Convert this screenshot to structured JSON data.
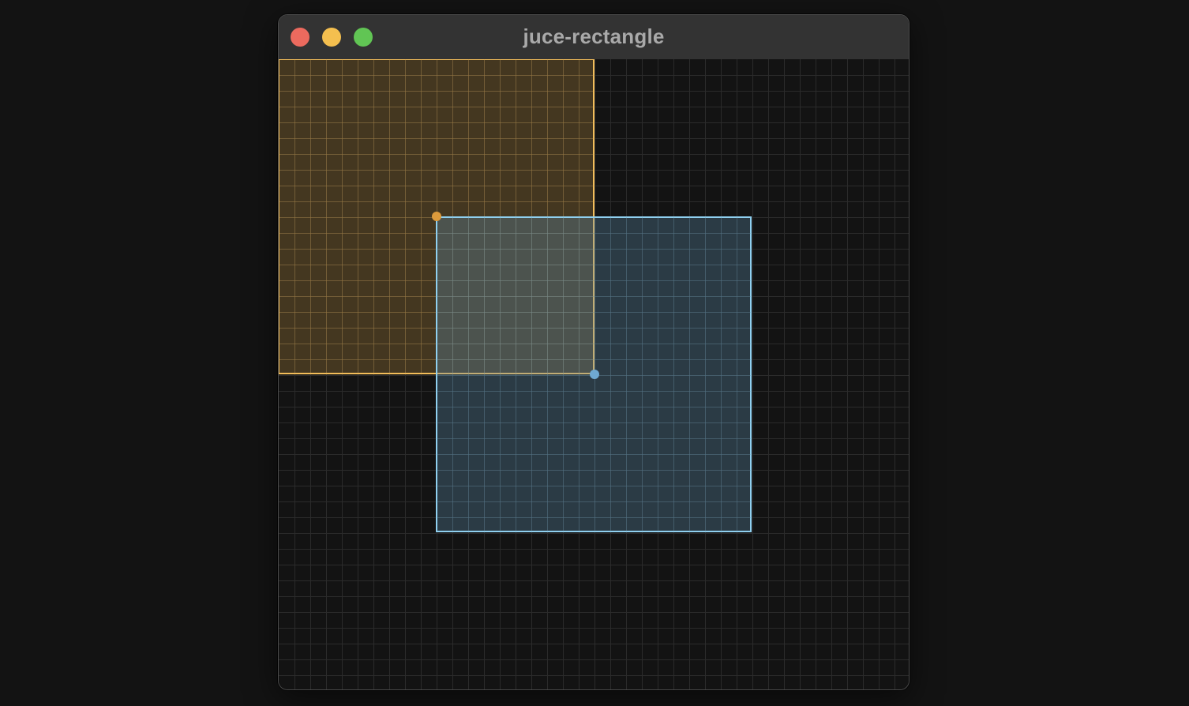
{
  "window": {
    "title": "juce-rectangle",
    "controls": {
      "close_color": "#ec6a5e",
      "minimize_color": "#f4bf4f",
      "zoom_color": "#61c554"
    }
  },
  "canvas": {
    "background_color": "#131313",
    "grid_color": "#2b2b2b",
    "rectangle_a": {
      "stroke_color": "#f2bd5a",
      "fill_color": "#d9a249",
      "handle_color": "#dd9b3c"
    },
    "rectangle_b": {
      "stroke_color": "#8fd0f0",
      "fill_color": "#5f8fad",
      "handle_color": "#6fa9d2"
    }
  }
}
